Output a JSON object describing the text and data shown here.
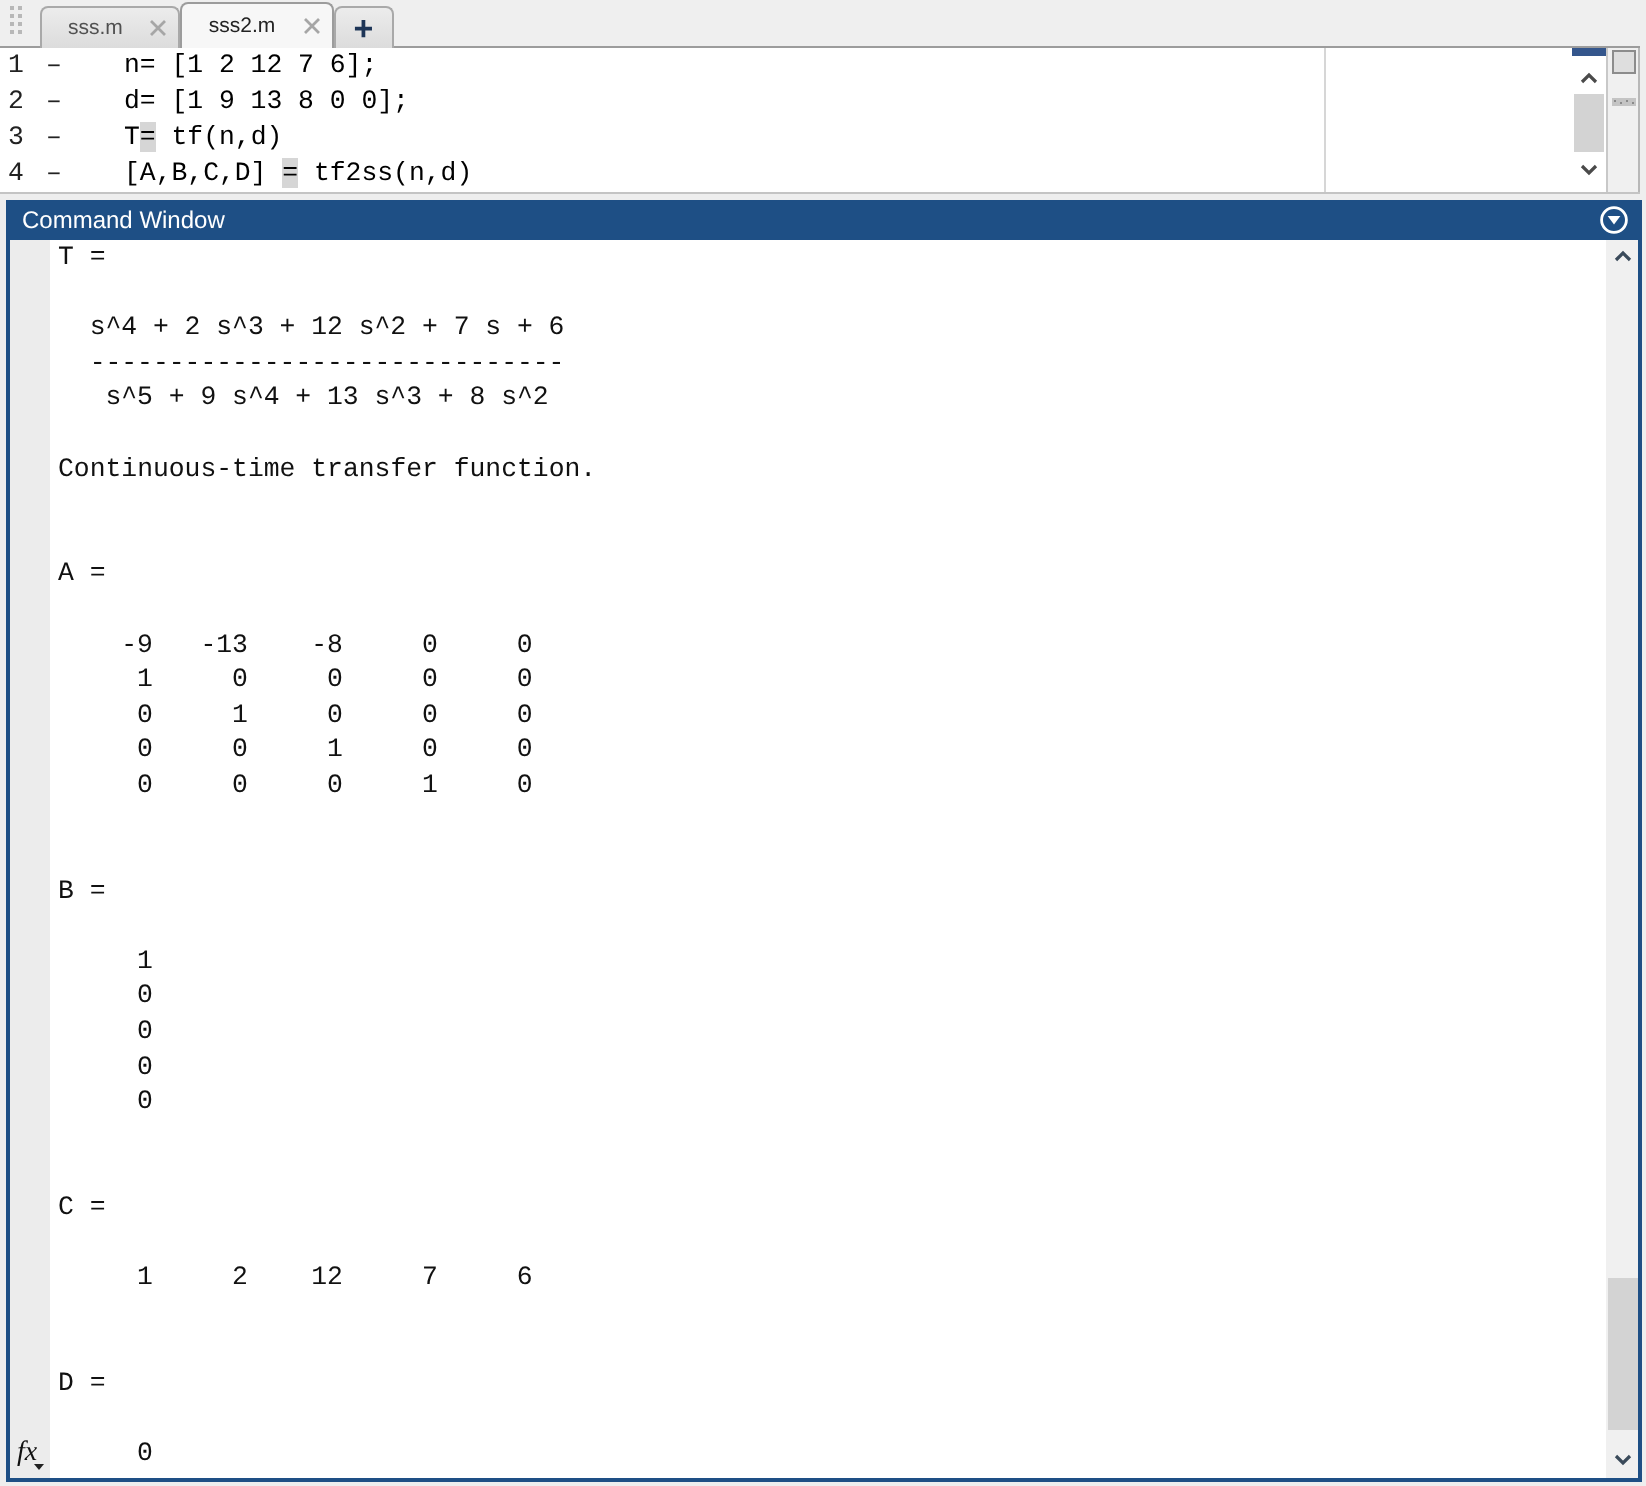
{
  "editor_tabs": [
    {
      "label": "sss.m",
      "selected": false
    },
    {
      "label": "sss2.m",
      "selected": true
    }
  ],
  "new_tab": {
    "label": "+"
  },
  "editor": {
    "lines": [
      {
        "number": "1",
        "marker": "–",
        "segments": [
          {
            "text": "n= [1 2 12 7 6];",
            "flagged": false
          }
        ]
      },
      {
        "number": "2",
        "marker": "–",
        "segments": [
          {
            "text": "d= [1 9 13 8 0 0];",
            "flagged": false
          }
        ]
      },
      {
        "number": "3",
        "marker": "–",
        "segments": [
          {
            "text": "T",
            "flagged": false
          },
          {
            "text": "=",
            "flagged": true
          },
          {
            "text": " tf(n,d)",
            "flagged": false
          }
        ]
      },
      {
        "number": "4",
        "marker": "–",
        "segments": [
          {
            "text": "[A,B,C,D] ",
            "flagged": false
          },
          {
            "text": "=",
            "flagged": true
          },
          {
            "text": " tf2ss(n,d)",
            "flagged": false
          }
        ]
      }
    ]
  },
  "command_window": {
    "title": "Command Window",
    "function_browser": "fx",
    "variables": [
      {
        "kind": "transfer_function",
        "name": "T =",
        "numerator": "s^4 + 2 s^3 + 12 s^2 + 7 s + 6",
        "fraction_bar": "------------------------------",
        "denominator": "s^5 + 9 s^4 + 13 s^3 + 8 s^2",
        "note": "Continuous-time transfer function."
      },
      {
        "kind": "matrix",
        "name": "A =",
        "rows": [
          [
            "-9",
            "-13",
            "-8",
            "0",
            "0"
          ],
          [
            "1",
            "0",
            "0",
            "0",
            "0"
          ],
          [
            "0",
            "1",
            "0",
            "0",
            "0"
          ],
          [
            "0",
            "0",
            "1",
            "0",
            "0"
          ],
          [
            "0",
            "0",
            "0",
            "1",
            "0"
          ]
        ]
      },
      {
        "kind": "matrix",
        "name": "B =",
        "rows": [
          [
            "1"
          ],
          [
            "0"
          ],
          [
            "0"
          ],
          [
            "0"
          ],
          [
            "0"
          ]
        ]
      },
      {
        "kind": "matrix",
        "name": "C =",
        "rows": [
          [
            "1",
            "2",
            "12",
            "7",
            "6"
          ]
        ]
      },
      {
        "kind": "matrix",
        "name": "D =",
        "rows": [
          [
            "0"
          ]
        ]
      }
    ]
  }
}
